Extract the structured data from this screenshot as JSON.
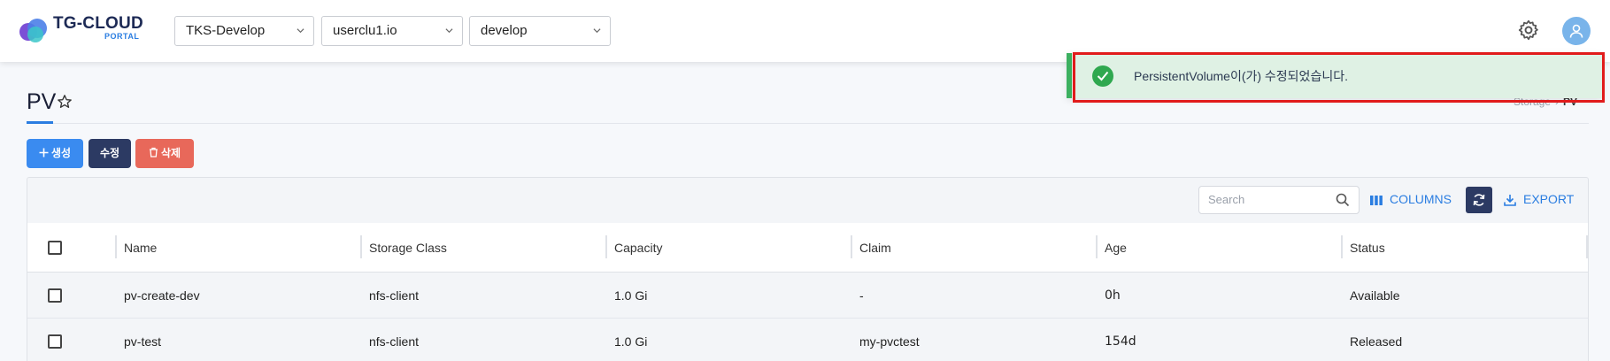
{
  "header": {
    "logo_title": "TG-CLOUD",
    "logo_sub": "PORTAL",
    "selectors": [
      {
        "value": "TKS-Develop"
      },
      {
        "value": "userclu1.io"
      },
      {
        "value": "develop"
      }
    ],
    "icons": {
      "settings": "gear-icon",
      "user": "user-icon"
    }
  },
  "page": {
    "title": "PV",
    "breadcrumb": [
      "Storage",
      "PV"
    ]
  },
  "actions": {
    "create_label": "생성",
    "edit_label": "수정",
    "delete_label": "삭제"
  },
  "toolbar": {
    "search_placeholder": "Search",
    "columns_label": "COLUMNS",
    "export_label": "EXPORT"
  },
  "table": {
    "columns": [
      "Name",
      "Storage Class",
      "Capacity",
      "Claim",
      "Age",
      "Status"
    ],
    "rows": [
      {
        "name": "pv-create-dev",
        "storage_class": "nfs-client",
        "capacity": "1.0 Gi",
        "claim": "-",
        "age": "0h",
        "status": "Available"
      },
      {
        "name": "pv-test",
        "storage_class": "nfs-client",
        "capacity": "1.0 Gi",
        "claim": "my-pvctest",
        "age": "154d",
        "status": "Released"
      }
    ]
  },
  "toast": {
    "message": "PersistentVolume이(가) 수정되었습니다.",
    "type": "success"
  },
  "colors": {
    "accent": "#2a7de1",
    "navy": "#2c3a63",
    "danger": "#e8685a",
    "success": "#2fa84f",
    "highlight_frame": "#e11b1b"
  }
}
